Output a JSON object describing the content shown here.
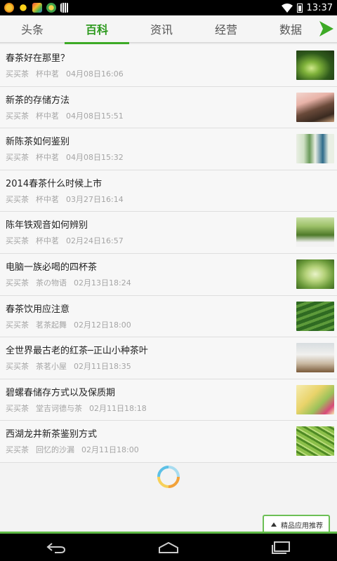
{
  "status_bar": {
    "time": "13:37",
    "icons": [
      "app-icon-orange",
      "sun-icon",
      "app-icon-colorful",
      "app-icon-green",
      "barcode-icon",
      "wifi-icon",
      "battery-icon"
    ]
  },
  "tabs": [
    {
      "label": "头条",
      "active": false
    },
    {
      "label": "百科",
      "active": true
    },
    {
      "label": "资讯",
      "active": false
    },
    {
      "label": "经营",
      "active": false
    },
    {
      "label": "数据",
      "active": false
    }
  ],
  "tab_arrow_icon": "forward-arrow-icon",
  "accent_color": "#3daa26",
  "articles": [
    {
      "title": "春茶好在那里？",
      "source": "买买茶",
      "author": "杯中茗",
      "date": "04月08日16:06",
      "thumb": "tea-leaves-photo"
    },
    {
      "title": "新茶的存储方法",
      "source": "买买茶",
      "author": "杯中茗",
      "date": "04月08日15:51",
      "thumb": "tea-pot-photo"
    },
    {
      "title": "新陈茶如何鉴别",
      "source": "买买茶",
      "author": "杯中茗",
      "date": "04月08日15:32",
      "thumb": "tea-boxes-photo"
    },
    {
      "title": "2014春茶什么时候上市",
      "source": "买买茶",
      "author": "杯中茗",
      "date": "03月27日16:14",
      "thumb": ""
    },
    {
      "title": "陈年铁观音如何辨别",
      "source": "买买茶",
      "author": "杯中茗",
      "date": "02月24日16:57",
      "thumb": "tieguanyin-photo"
    },
    {
      "title": "电脑一族必喝的四杯茶",
      "source": "买买茶",
      "author": "茶の物语",
      "date": "02月13日18:24",
      "thumb": "green-tea-cup-photo"
    },
    {
      "title": "春茶饮用应注意",
      "source": "买买茶",
      "author": "茗茶起舞",
      "date": "02月12日18:00",
      "thumb": "tea-field-photo"
    },
    {
      "title": "全世界最古老的红茶─正山小种茶叶",
      "source": "买买茶",
      "author": "茶茗小屋",
      "date": "02月11日18:35",
      "thumb": "black-tea-box-photo"
    },
    {
      "title": "碧螺春储存方式以及保质期",
      "source": "买买茶",
      "author": "堂吉诃德与茶",
      "date": "02月11日18:18",
      "thumb": "biluochun-package-photo"
    },
    {
      "title": "西湖龙井新茶鉴别方式",
      "source": "买买茶",
      "author": "回忆的沙漏",
      "date": "02月11日18:00",
      "thumb": "longjing-leaves-photo"
    }
  ],
  "recommend_label": "精品应用推荐",
  "nav": {
    "back_icon": "back-icon",
    "home_icon": "home-icon",
    "recents_icon": "recents-icon"
  }
}
